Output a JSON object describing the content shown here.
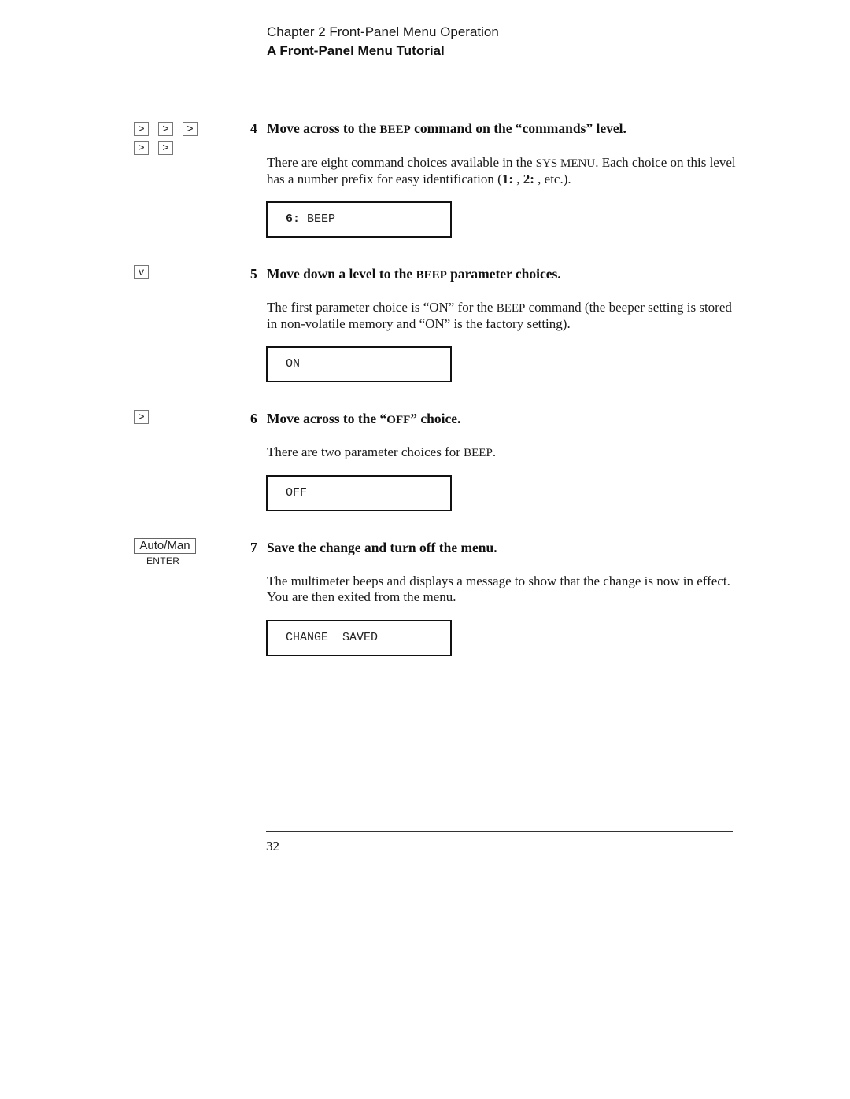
{
  "header": {
    "chapter": "Chapter 2  Front-Panel Menu Operation",
    "section": "A Front-Panel Menu Tutorial"
  },
  "keys": {
    "right_arrow": ">",
    "down_arrow": "v",
    "auto_man": "Auto/Man",
    "enter_caption": "ENTER"
  },
  "steps": [
    {
      "number": "4",
      "title_pre": "Move across to the ",
      "title_sc": "BEEP",
      "title_post": " command on the “commands” level.",
      "body_1": "There are eight command choices available in the ",
      "body_sc": "SYS MENU",
      "body_2": ". Each choice on this level has a number prefix for easy identification (",
      "body_b1": "1:",
      "body_3": " , ",
      "body_b2": "2:",
      "body_4": " , etc.).",
      "display_prefix": "6:",
      "display_text": " BEEP",
      "key_icons": [
        "right-arrow",
        "right-arrow",
        "right-arrow",
        "right-arrow",
        "right-arrow"
      ]
    },
    {
      "number": "5",
      "title_pre": "Move down a level to the ",
      "title_sc": "BEEP",
      "title_post": " parameter choices.",
      "body_1": "The first parameter choice is “ON” for the ",
      "body_sc": "BEEP",
      "body_2": " command (the beeper setting is stored in non-volatile memory and “ON” is the factory setting).",
      "display_text": "ON",
      "key_icons": [
        "down-arrow"
      ]
    },
    {
      "number": "6",
      "title_pre": "Move across to the “",
      "title_sc": "OFF",
      "title_post": "” choice.",
      "body_1": "There are two parameter choices for ",
      "body_sc": "BEEP",
      "body_2": ".",
      "display_text": "OFF",
      "key_icons": [
        "right-arrow"
      ]
    },
    {
      "number": "7",
      "title": "Save the change and turn off the menu.",
      "body": "The multimeter beeps and displays a message to show that the change is now in effect. You are then exited from the menu.",
      "display_text": "CHANGE  SAVED",
      "key_icons": [
        "auto-man-enter"
      ]
    }
  ],
  "footer": {
    "page_number": "32"
  }
}
